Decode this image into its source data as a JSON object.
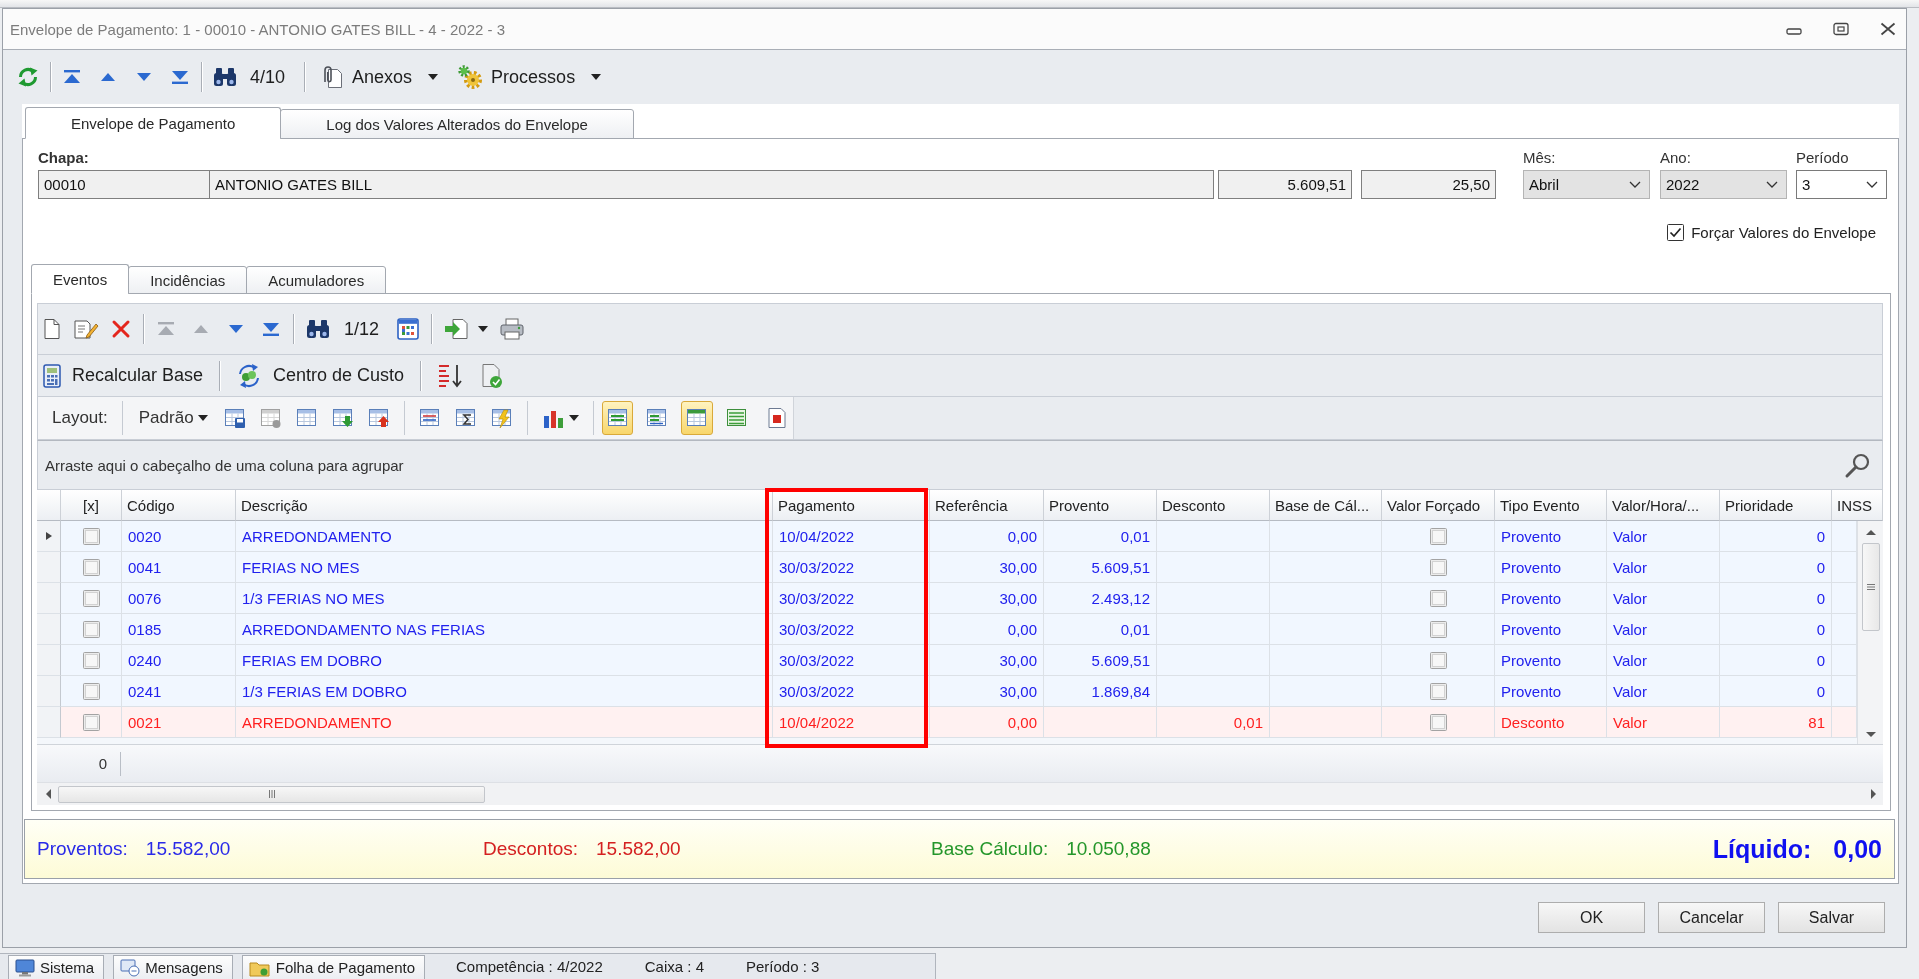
{
  "window": {
    "title": "Envelope de Pagamento: 1 - 00010 - ANTONIO GATES BILL - 4 - 2022 - 3"
  },
  "toolbar": {
    "navigation": [
      {
        "kind": "first",
        "disabled": false
      },
      {
        "kind": "previous",
        "disabled": false
      },
      {
        "kind": "next",
        "disabled": false
      },
      {
        "kind": "last",
        "disabled": false
      }
    ],
    "record_counter": "4/10",
    "menus": [
      {
        "kind": "attachments",
        "label": "Anexos"
      },
      {
        "kind": "processes",
        "label": "Processos"
      }
    ]
  },
  "tabs": [
    {
      "label": "Envelope de Pagamento",
      "selected": true
    },
    {
      "label": "Log dos Valores Alterados do Envelope",
      "selected": false
    }
  ],
  "form": {
    "chapa_label": "Chapa:",
    "chapa_code": "00010",
    "employee_name": "ANTONIO GATES BILL",
    "field_3": "5.609,51",
    "field_4": "25,50",
    "selects": [
      {
        "label": "Mês:",
        "value": "Abril",
        "disabled": true
      },
      {
        "label": "Ano:",
        "value": "2022",
        "disabled": true
      },
      {
        "label": "Período",
        "value": "3",
        "disabled": false
      }
    ],
    "force_values": {
      "label": "Forçar Valores do Envelope",
      "checked": true
    }
  },
  "events_tabs": [
    {
      "label": "Eventos",
      "selected": true
    },
    {
      "label": "Incidências",
      "selected": false
    },
    {
      "label": "Acumuladores",
      "selected": false
    }
  ],
  "events_toolbar": {
    "navigation": [
      {
        "kind": "first",
        "disabled": true
      },
      {
        "kind": "previous",
        "disabled": true
      },
      {
        "kind": "next",
        "disabled": false
      },
      {
        "kind": "last",
        "disabled": false
      }
    ],
    "record_counter": "1/12"
  },
  "actions": [
    {
      "kind": "recalculate",
      "label": "Recalcular Base"
    },
    {
      "kind": "cost_center",
      "label": "Centro de Custo"
    }
  ],
  "layout_bar": {
    "label": "Layout:",
    "preset": "Padrão",
    "view_toggles": [
      {
        "on": true
      },
      {
        "on": false
      },
      {
        "on": true
      },
      {
        "on": false
      },
      {
        "on": false
      }
    ]
  },
  "group_panel": {
    "hint": "Arraste aqui o cabeçalho de uma coluna para agrupar"
  },
  "grid": {
    "columns": [
      {
        "kind": "mark",
        "label": "[x]",
        "highlighted": false
      },
      {
        "kind": "codigo",
        "label": "Código",
        "highlighted": false
      },
      {
        "kind": "descricao",
        "label": "Descrição",
        "highlighted": false
      },
      {
        "kind": "pagamento",
        "label": "Pagamento",
        "highlighted": true
      },
      {
        "kind": "referencia",
        "label": "Referência",
        "highlighted": false
      },
      {
        "kind": "provento",
        "label": "Provento",
        "highlighted": false
      },
      {
        "kind": "desconto",
        "label": "Desconto",
        "highlighted": false
      },
      {
        "kind": "base_calculo",
        "label": "Base de Cál...",
        "highlighted": false
      },
      {
        "kind": "valor_forcado",
        "label": "Valor Forçado",
        "highlighted": false
      },
      {
        "kind": "tipo_evento",
        "label": "Tipo Evento",
        "highlighted": false
      },
      {
        "kind": "valor_hora",
        "label": "Valor/Hora/...",
        "highlighted": false
      },
      {
        "kind": "prioridade",
        "label": "Prioridade",
        "highlighted": false
      },
      {
        "kind": "inss",
        "label": "INSS",
        "highlighted": false
      }
    ],
    "rows": [
      {
        "current": true,
        "kind": "provento",
        "mark": false,
        "codigo": "0020",
        "descricao": "ARREDONDAMENTO",
        "pagamento": "10/04/2022",
        "referencia": "0,00",
        "provento": "0,01",
        "valor_forcado": false,
        "tipo_evento": "Provento",
        "valor_hora": "Valor",
        "prioridade": "0"
      },
      {
        "current": false,
        "kind": "provento",
        "mark": false,
        "codigo": "0041",
        "descricao": "FERIAS NO MES",
        "pagamento": "30/03/2022",
        "referencia": "30,00",
        "provento": "5.609,51",
        "valor_forcado": false,
        "tipo_evento": "Provento",
        "valor_hora": "Valor",
        "prioridade": "0"
      },
      {
        "current": false,
        "kind": "provento",
        "mark": false,
        "codigo": "0076",
        "descricao": "1/3 FERIAS NO MES",
        "pagamento": "30/03/2022",
        "referencia": "30,00",
        "provento": "2.493,12",
        "valor_forcado": false,
        "tipo_evento": "Provento",
        "valor_hora": "Valor",
        "prioridade": "0"
      },
      {
        "current": false,
        "kind": "provento",
        "mark": false,
        "codigo": "0185",
        "descricao": "ARREDONDAMENTO NAS FERIAS",
        "pagamento": "30/03/2022",
        "referencia": "0,00",
        "provento": "0,01",
        "valor_forcado": false,
        "tipo_evento": "Provento",
        "valor_hora": "Valor",
        "prioridade": "0"
      },
      {
        "current": false,
        "kind": "provento",
        "mark": false,
        "codigo": "0240",
        "descricao": "FERIAS EM DOBRO",
        "pagamento": "30/03/2022",
        "referencia": "30,00",
        "provento": "5.609,51",
        "valor_forcado": false,
        "tipo_evento": "Provento",
        "valor_hora": "Valor",
        "prioridade": "0"
      },
      {
        "current": false,
        "kind": "provento",
        "mark": false,
        "codigo": "0241",
        "descricao": "1/3 FERIAS EM DOBRO",
        "pagamento": "30/03/2022",
        "referencia": "30,00",
        "provento": "1.869,84",
        "valor_forcado": false,
        "tipo_evento": "Provento",
        "valor_hora": "Valor",
        "prioridade": "0"
      },
      {
        "current": false,
        "kind": "desconto",
        "mark": false,
        "codigo": "0021",
        "descricao": "ARREDONDAMENTO",
        "pagamento": "10/04/2022",
        "referencia": "0,00",
        "desconto": "0,01",
        "valor_forcado": false,
        "tipo_evento": "Desconto",
        "valor_hora": "Valor",
        "prioridade": "81"
      }
    ],
    "footer_count": "0"
  },
  "summary": {
    "items": [
      {
        "kind": "proventos",
        "label": "Proventos:",
        "value": "15.582,00"
      },
      {
        "kind": "descontos",
        "label": "Descontos:",
        "value": "15.582,00"
      },
      {
        "kind": "base",
        "label": "Base Cálculo:",
        "value": "10.050,88"
      }
    ],
    "net": {
      "label": "Líquido:",
      "value": "0,00"
    }
  },
  "buttons": [
    {
      "label": "OK"
    },
    {
      "label": "Cancelar"
    },
    {
      "label": "Salvar"
    }
  ],
  "taskbar": {
    "tabs": [
      {
        "kind": "system",
        "label": "Sistema"
      },
      {
        "kind": "messages",
        "label": "Mensagens"
      },
      {
        "kind": "payroll",
        "label": "Folha de Pagamento"
      }
    ],
    "status": [
      "Competência : 4/2022",
      "Caixa : 4",
      "Período : 3"
    ]
  }
}
